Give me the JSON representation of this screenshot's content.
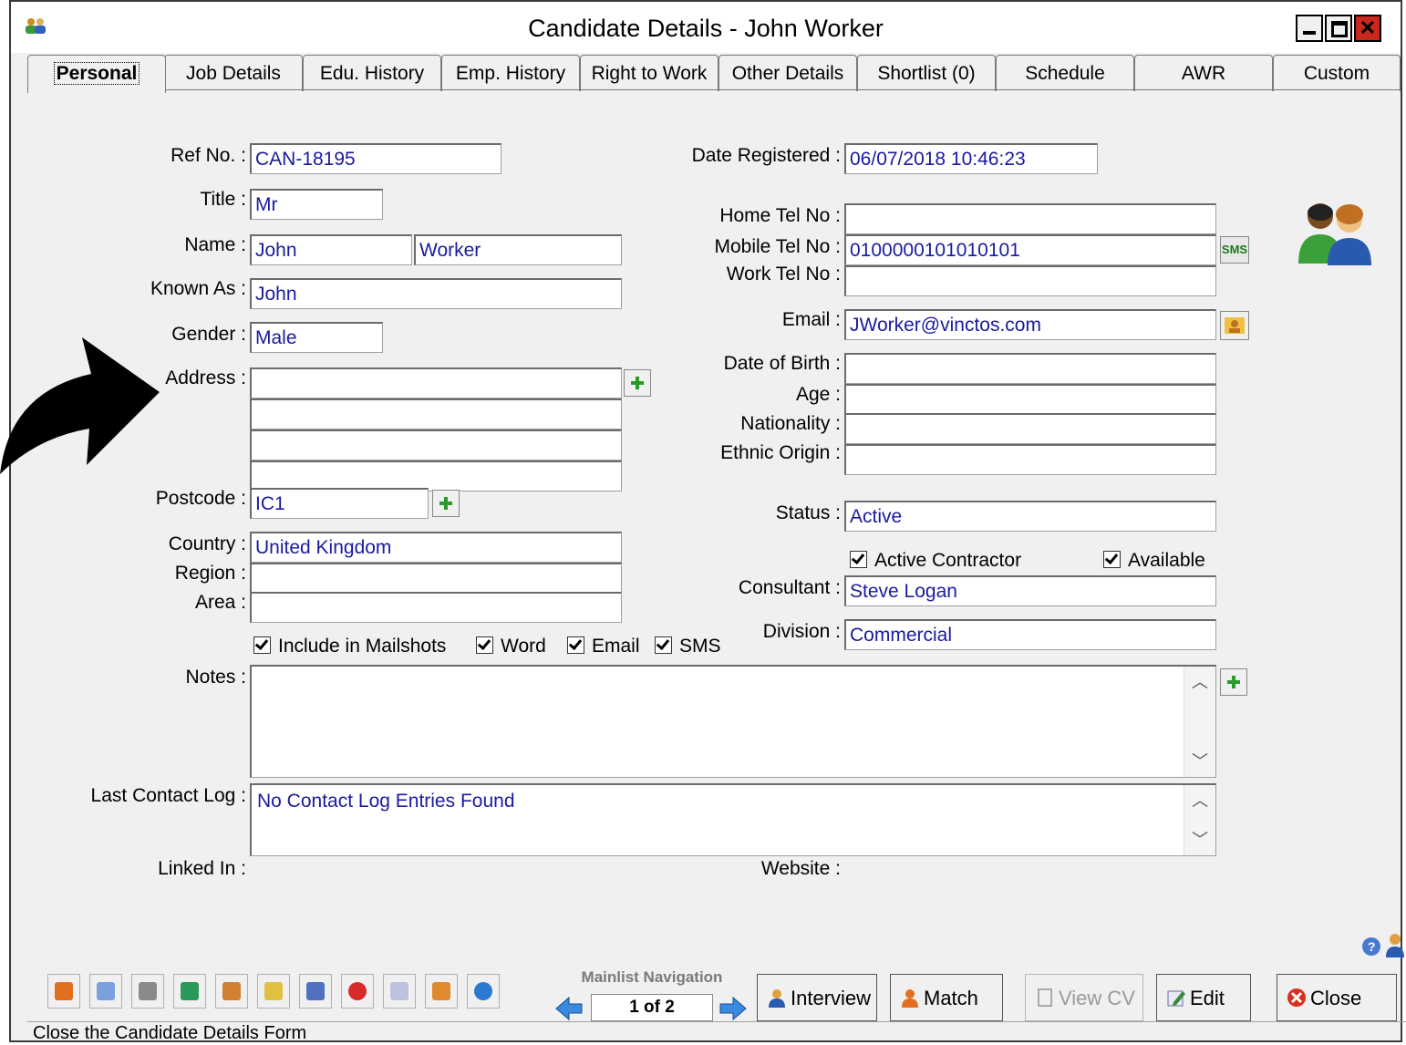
{
  "window": {
    "title": "Candidate Details - John Worker"
  },
  "tabs": [
    {
      "label": "Personal"
    },
    {
      "label": "Job Details"
    },
    {
      "label": "Edu. History"
    },
    {
      "label": "Emp. History"
    },
    {
      "label": "Right to Work"
    },
    {
      "label": "Other Details"
    },
    {
      "label": "Shortlist (0)"
    },
    {
      "label": "Schedule"
    },
    {
      "label": "AWR"
    },
    {
      "label": "Custom"
    }
  ],
  "left": {
    "ref_label": "Ref No. :",
    "ref_value": "CAN-18195",
    "title_label": "Title :",
    "title_value": "Mr",
    "name_label": "Name :",
    "first_name": "John",
    "last_name": "Worker",
    "known_label": "Known As :",
    "known_value": "John",
    "gender_label": "Gender :",
    "gender_value": "Male",
    "address_label": "Address :",
    "postcode_label": "Postcode :",
    "postcode_value": "IC1",
    "country_label": "Country :",
    "country_value": "United Kingdom",
    "region_label": "Region :",
    "area_label": "Area :"
  },
  "right": {
    "date_label": "Date Registered :",
    "date_value": "06/07/2018 10:46:23",
    "home_label": "Home Tel No :",
    "mobile_label": "Mobile Tel No :",
    "mobile_value": "0100000101010101",
    "work_label": "Work Tel No :",
    "email_label": "Email :",
    "email_value": "JWorker@vinctos.com",
    "dob_label": "Date of Birth :",
    "age_label": "Age :",
    "nationality_label": "Nationality :",
    "ethnic_label": "Ethnic Origin :",
    "status_label": "Status :",
    "status_value": "Active",
    "active_contractor": "Active Contractor",
    "available": "Available",
    "consultant_label": "Consultant :",
    "consultant_value": "Steve Logan",
    "division_label": "Division :",
    "division_value": "Commercial",
    "sms_label": "SMS"
  },
  "mailshots": {
    "include": "Include in Mailshots",
    "word": "Word",
    "email": "Email",
    "sms": "SMS"
  },
  "notes_label": "Notes :",
  "contact": {
    "label": "Last Contact Log :",
    "value": "No Contact Log Entries Found"
  },
  "linked_in_label": "Linked In :",
  "website_label": "Website :",
  "navigation": {
    "label": "Mainlist Navigation",
    "position": "1 of 2"
  },
  "buttons": {
    "interview": "Interview",
    "match": "Match",
    "view_cv": "View CV",
    "edit": "Edit",
    "close": "Close"
  },
  "status_text": "Close the Candidate Details Form",
  "colors": {
    "field_text": "#1a1aa0",
    "background": "#f0f0f0",
    "close_button": "#c8281e"
  }
}
